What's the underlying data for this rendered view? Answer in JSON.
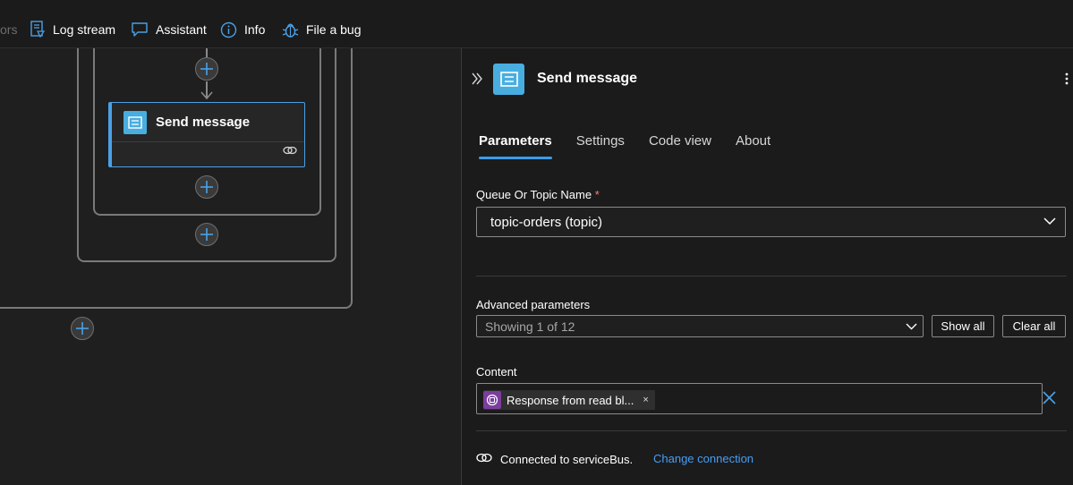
{
  "toolbar": {
    "items": [
      {
        "label": "ors",
        "icon": "errors-icon"
      },
      {
        "label": "Log stream",
        "icon": "log-stream-icon"
      },
      {
        "label": "Assistant",
        "icon": "chat-icon"
      },
      {
        "label": "Info",
        "icon": "info-icon"
      },
      {
        "label": "File a bug",
        "icon": "bug-icon"
      }
    ]
  },
  "canvas": {
    "action_card": {
      "title": "Send message",
      "icon": "service-bus-icon"
    }
  },
  "panel": {
    "title": "Send message",
    "tabs": [
      {
        "label": "Parameters",
        "active": true
      },
      {
        "label": "Settings",
        "active": false
      },
      {
        "label": "Code view",
        "active": false
      },
      {
        "label": "About",
        "active": false
      }
    ],
    "queue_label": "Queue Or Topic Name",
    "required_mark": "*",
    "queue_value": "topic-orders (topic)",
    "advanced_label": "Advanced parameters",
    "advanced_value": "Showing 1 of 12",
    "show_all": "Show all",
    "clear_all": "Clear all",
    "content_label": "Content",
    "content_token": "Response from read bl...",
    "token_remove": "×",
    "connection_text": "Connected to serviceBus.",
    "change_connection": "Change connection"
  },
  "colors": {
    "accent": "#3d9be9",
    "service_bus": "#48aee0",
    "token_purple": "#7a3e9d",
    "link": "#479ef5"
  }
}
